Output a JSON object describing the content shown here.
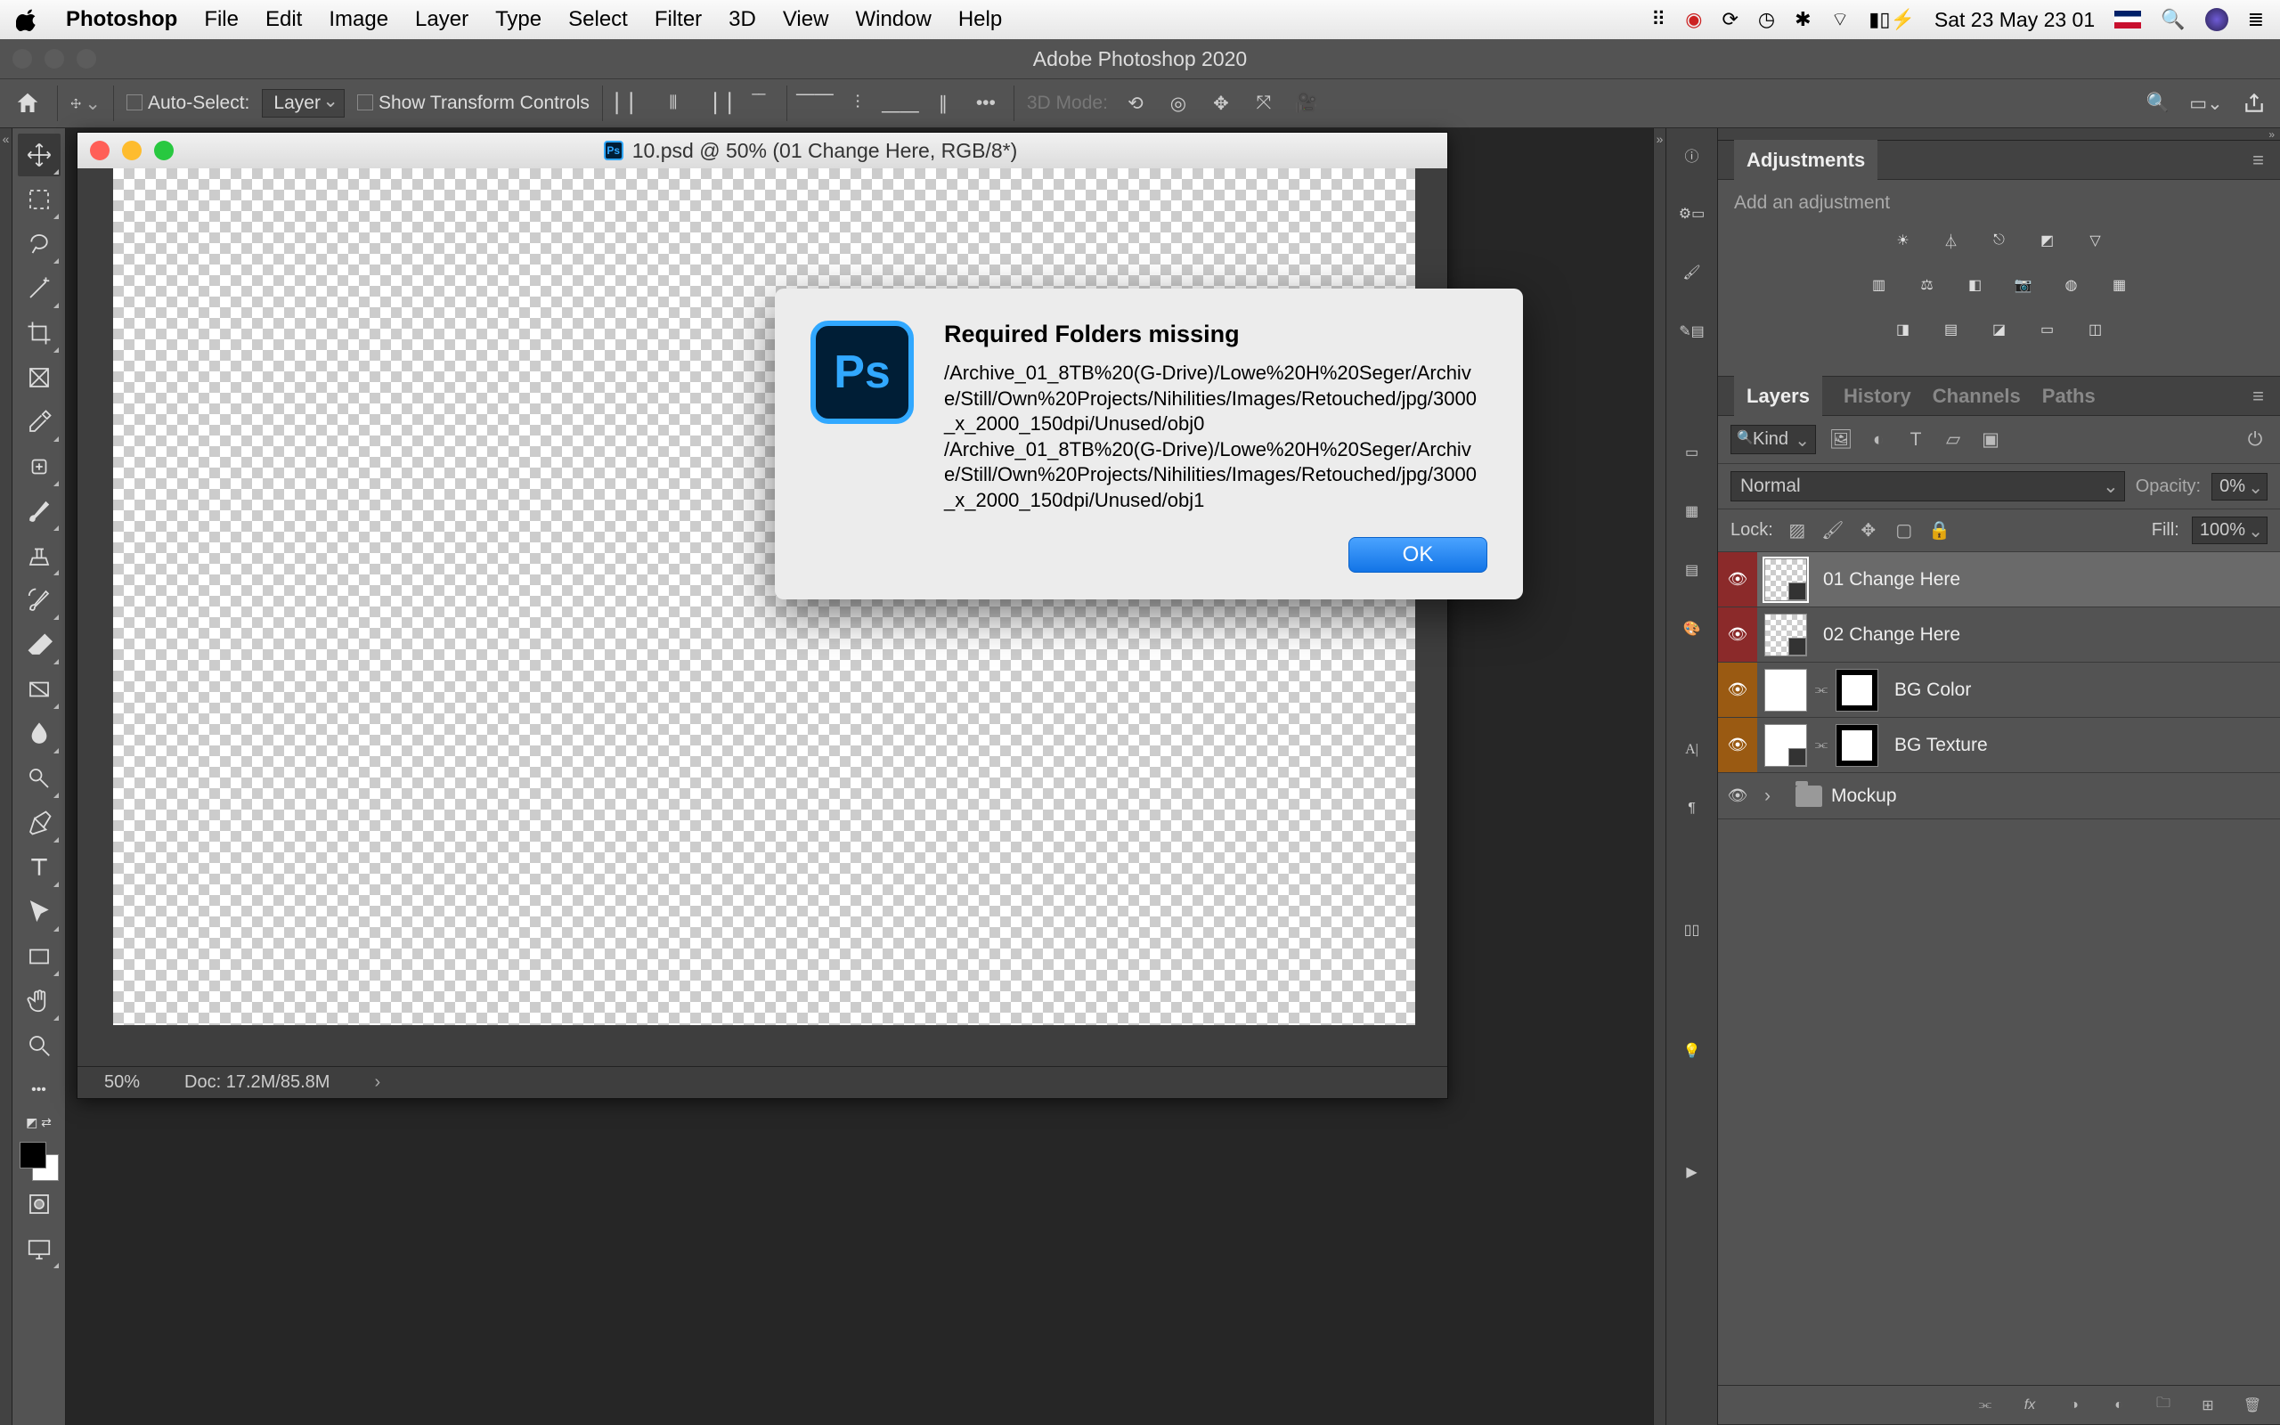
{
  "menubar": {
    "app": "Photoshop",
    "items": [
      "File",
      "Edit",
      "Image",
      "Layer",
      "Type",
      "Select",
      "Filter",
      "3D",
      "View",
      "Window",
      "Help"
    ],
    "clock": "Sat 23 May  23 01"
  },
  "window_title": "Adobe Photoshop 2020",
  "optbar": {
    "auto_select_label": "Auto-Select:",
    "auto_select_target": "Layer",
    "show_transform": "Show Transform Controls",
    "mode3d": "3D Mode:"
  },
  "document": {
    "title": "10.psd @ 50% (01 Change Here, RGB/8*)",
    "zoom": "50%",
    "docsize": "Doc: 17.2M/85.8M"
  },
  "dialog": {
    "title": "Required Folders missing",
    "lines": [
      "/Archive_01_8TB%20(G-Drive)/Lowe%20H%20Seger/Archive/Still/Own%20Projects/Nihilities/Images/Retouched/jpg/3000_x_2000_150dpi/Unused/obj0",
      "/Archive_01_8TB%20(G-Drive)/Lowe%20H%20Seger/Archive/Still/Own%20Projects/Nihilities/Images/Retouched/jpg/3000_x_2000_150dpi/Unused/obj1"
    ],
    "ok": "OK"
  },
  "adjustments": {
    "title": "Adjustments",
    "hint": "Add an adjustment"
  },
  "layers_panel": {
    "tabs": [
      "Layers",
      "History",
      "Channels",
      "Paths"
    ],
    "kind": "Kind",
    "blend": "Normal",
    "opacity_label": "Opacity:",
    "opacity": "0%",
    "lock_label": "Lock:",
    "fill_label": "Fill:",
    "fill": "100%",
    "layers": [
      {
        "name": "01 Change Here"
      },
      {
        "name": "02 Change Here"
      },
      {
        "name": "BG Color"
      },
      {
        "name": "BG Texture"
      },
      {
        "name": "Mockup"
      }
    ]
  }
}
